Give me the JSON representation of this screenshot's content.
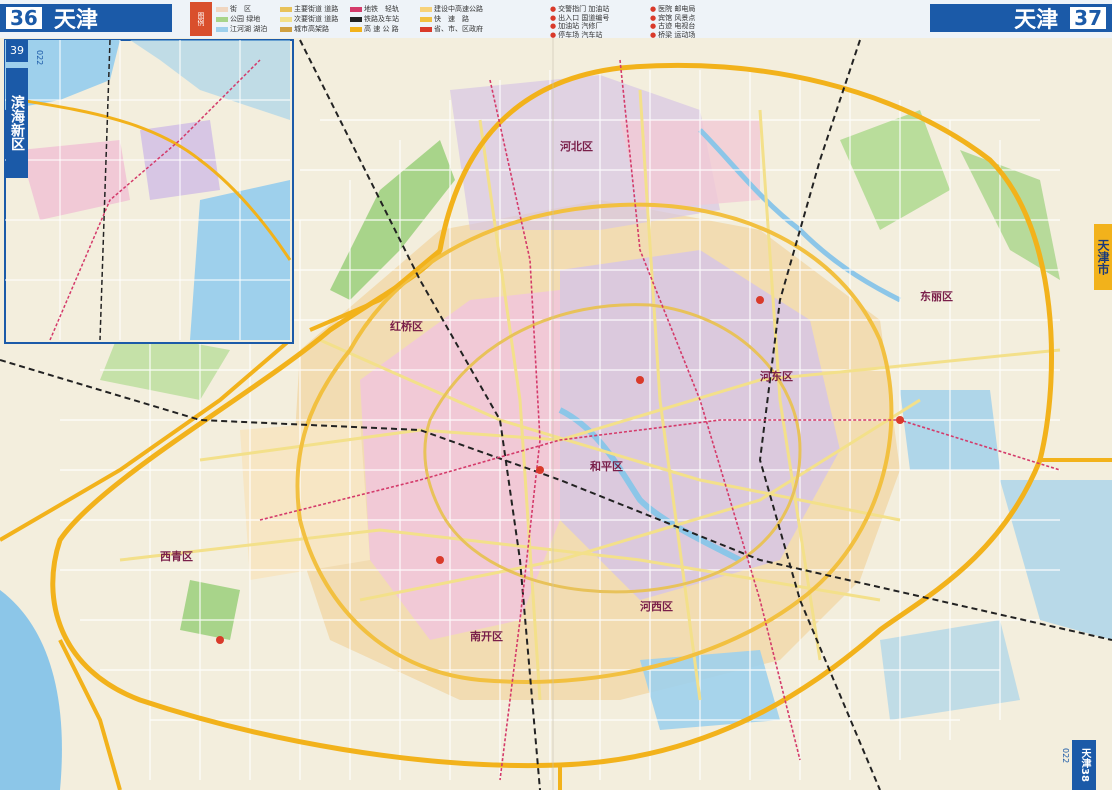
{
  "header": {
    "left_page": "36",
    "left_city": "天津",
    "right_city": "天津",
    "right_page": "37"
  },
  "legend": {
    "title": "图例",
    "items": [
      {
        "label": "街　区",
        "color": "#f0d6c0"
      },
      {
        "label": "公园 绿地",
        "color": "#a8d48a"
      },
      {
        "label": "江河湖 湖泊",
        "color": "#9ed0ec"
      },
      {
        "label": "主要街道 道路",
        "color": "#e8c25a"
      },
      {
        "label": "次要街道 道路",
        "color": "#f3e08a"
      },
      {
        "label": "城市高架路",
        "color": "#d0a040"
      },
      {
        "label": "地铁　轻轨",
        "color": "#d43a6a"
      },
      {
        "label": "铁路及车站",
        "color": "#222222"
      },
      {
        "label": "高 速 公 路",
        "color": "#f2b21b"
      },
      {
        "label": "建设中高速公路",
        "color": "#f7d27a"
      },
      {
        "label": "快　速　路",
        "color": "#f2c040"
      },
      {
        "label": "省、市、区政府",
        "color": "#d93a2a"
      }
    ],
    "items2": [
      "交警指门 加油站",
      "出入口 国道编号",
      "加油站 汽修厂",
      "停车场 汽车站",
      "医院 邮电局",
      "宾馆 风景点",
      "古迹 电视台",
      "桥梁 运动场"
    ]
  },
  "inset": {
    "code": "022",
    "name": "滨海新区",
    "page": "39"
  },
  "side_tab": "天津市",
  "bottom_tab": {
    "name": "天津",
    "page": "38",
    "code": "022"
  },
  "map_labels": {
    "districts": [
      {
        "name": "南开区"
      },
      {
        "name": "河北区"
      },
      {
        "name": "河东区"
      },
      {
        "name": "河西区"
      },
      {
        "name": "和平区"
      },
      {
        "name": "红桥区"
      },
      {
        "name": "东丽区"
      },
      {
        "name": "西青区"
      }
    ]
  },
  "colors": {
    "accent": "#1b5aa8",
    "expressway": "#f2b21b",
    "river": "#8cc6e8",
    "park": "#a8d48a",
    "district_pink": "#f1c9d6",
    "district_lilac": "#d7c6e4",
    "district_tan": "#f2dcb2"
  }
}
